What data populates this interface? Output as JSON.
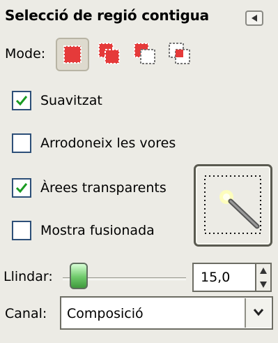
{
  "panel": {
    "title": "Selecció de regió contigua"
  },
  "mode": {
    "label": "Mode:",
    "options": [
      "replace",
      "add",
      "subtract",
      "intersect"
    ],
    "selected": "replace"
  },
  "options": {
    "antialias": {
      "label": "Suavitzat",
      "checked": true
    },
    "feather": {
      "label": "Arrodoneix les vores",
      "checked": false
    },
    "transparent": {
      "label": "Àrees transparents",
      "checked": true
    },
    "merged": {
      "label": "Mostra fusionada",
      "checked": false
    }
  },
  "threshold": {
    "label": "Llindar:",
    "value": "15,0"
  },
  "channel": {
    "label": "Canal:",
    "value": "Composició"
  },
  "icons": {
    "panel_menu": "triangle-left-icon",
    "mode_replace": "replace-selection-icon",
    "mode_add": "add-selection-icon",
    "mode_subtract": "subtract-selection-icon",
    "mode_intersect": "intersect-selection-icon",
    "tool": "magic-wand-icon",
    "dropdown": "chevron-down-icon"
  },
  "colors": {
    "accent": "#e53a3a",
    "check": "#1a9b22",
    "slider": "#6ec96a"
  }
}
